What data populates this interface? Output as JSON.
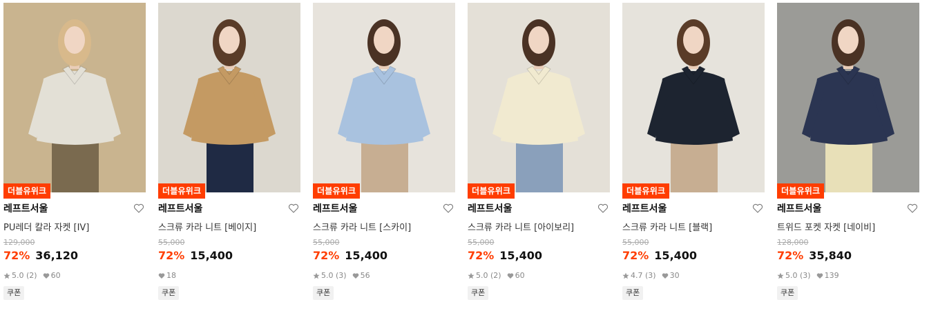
{
  "products": [
    {
      "badge": "더블유위크",
      "brand": "레프트서울",
      "name": "PU레더 칼라 자켓 [IV]",
      "original_price": "129,000",
      "discount": "72%",
      "price": "36,120",
      "rating": "5.0 (2)",
      "likes": "60",
      "coupon": "쿠폰",
      "colors": {
        "bg": "#c9b48f",
        "garment": "#e3e0d6",
        "hair": "#d8b98b",
        "accent": "#7a6a4f"
      }
    },
    {
      "badge": "더블유위크",
      "brand": "레프트서울",
      "name": "스크류 카라 니트 [베이지]",
      "original_price": "55,000",
      "discount": "72%",
      "price": "15,400",
      "rating": "",
      "likes": "18",
      "coupon": "쿠폰",
      "colors": {
        "bg": "#dcd8cf",
        "garment": "#c49a63",
        "hair": "#5a3c28",
        "accent": "#1f2a44"
      }
    },
    {
      "badge": "더블유위크",
      "brand": "레프트서울",
      "name": "스크류 카라 니트 [스카이]",
      "original_price": "55,000",
      "discount": "72%",
      "price": "15,400",
      "rating": "5.0 (3)",
      "likes": "56",
      "coupon": "쿠폰",
      "colors": {
        "bg": "#e7e3dc",
        "garment": "#a9c2df",
        "hair": "#4a3224",
        "accent": "#c7ae92"
      }
    },
    {
      "badge": "더블유위크",
      "brand": "레프트서울",
      "name": "스크류 카라 니트 [아이보리]",
      "original_price": "55,000",
      "discount": "72%",
      "price": "15,400",
      "rating": "5.0 (2)",
      "likes": "60",
      "coupon": "쿠폰",
      "colors": {
        "bg": "#e4e0d7",
        "garment": "#f1ead0",
        "hair": "#4a3224",
        "accent": "#8aa0bb"
      }
    },
    {
      "badge": "더블유위크",
      "brand": "레프트서울",
      "name": "스크류 카라 니트 [블랙]",
      "original_price": "55,000",
      "discount": "72%",
      "price": "15,400",
      "rating": "4.7 (3)",
      "likes": "30",
      "coupon": "쿠폰",
      "colors": {
        "bg": "#e6e3dc",
        "garment": "#1d2430",
        "hair": "#5a3c28",
        "accent": "#c7ae92"
      }
    },
    {
      "badge": "더블유위크",
      "brand": "레프트서울",
      "name": "트위드 포켓 자켓 [네이비]",
      "original_price": "128,000",
      "discount": "72%",
      "price": "35,840",
      "rating": "5.0 (3)",
      "likes": "139",
      "coupon": "쿠폰",
      "colors": {
        "bg": "#9b9b97",
        "garment": "#2b3552",
        "hair": "#4a3224",
        "accent": "#e8e0b8"
      }
    }
  ],
  "theme": {
    "accent": "#ff3d00",
    "text": "#111111",
    "muted": "#888888"
  }
}
